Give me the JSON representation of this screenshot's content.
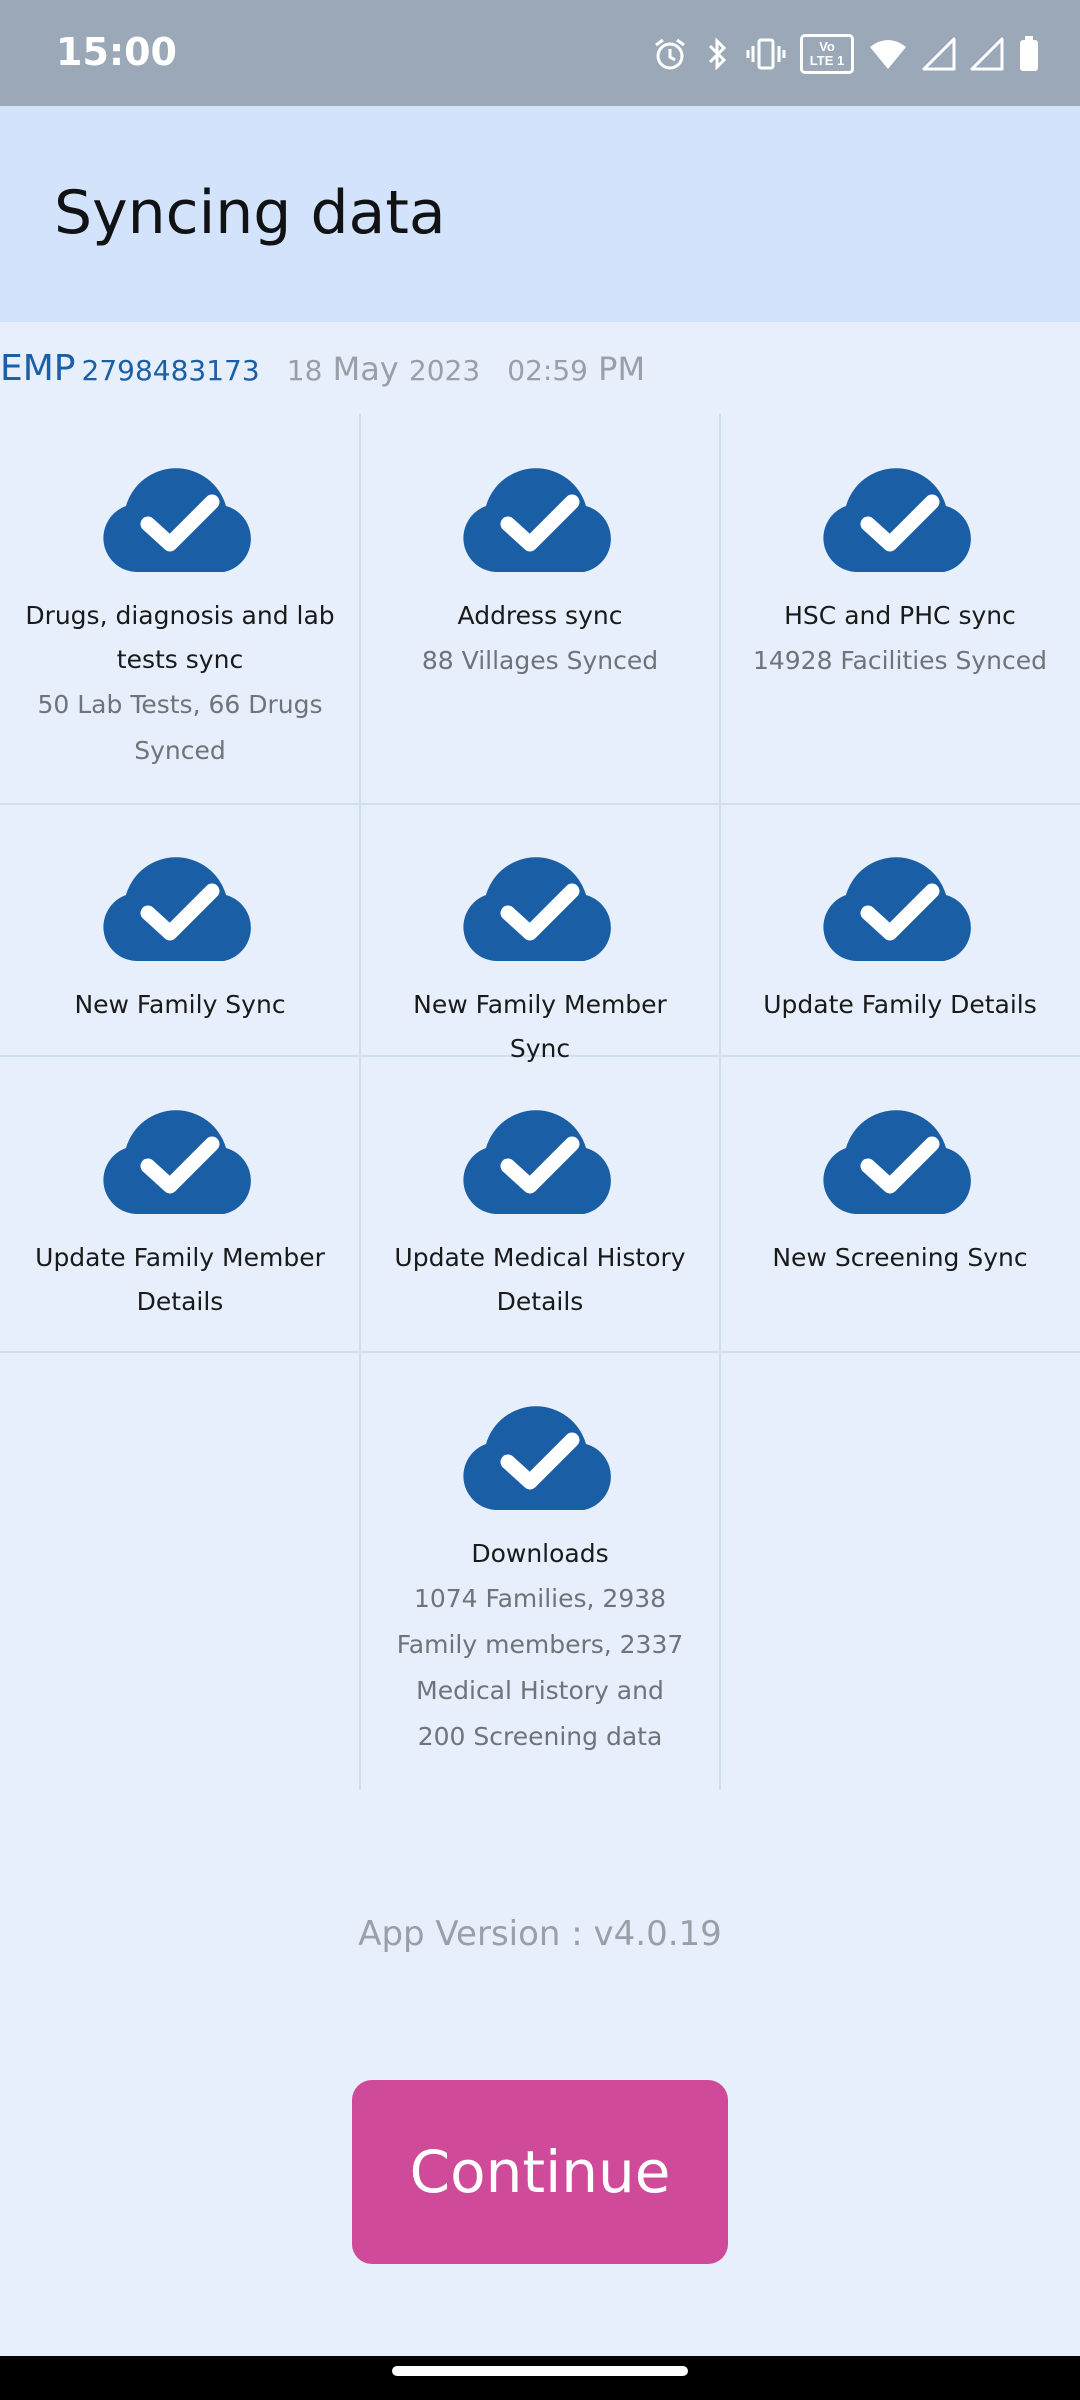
{
  "status_bar": {
    "time": "15:00",
    "icons": [
      "alarm-icon",
      "bluetooth-icon",
      "vibrate-icon",
      "volte-icon",
      "wifi-icon",
      "signal-icon",
      "signal-icon",
      "battery-icon"
    ],
    "volte_top": "Vo",
    "volte_bottom": "LTE 1"
  },
  "header": {
    "title": "Syncing data"
  },
  "meta": {
    "emp_label": "EMP",
    "emp_id": "2798483173",
    "date_day": "18",
    "date_month": "May",
    "date_year": "2023",
    "time_value": "02:59",
    "time_period": "PM"
  },
  "sync_items": [
    {
      "title": "Drugs, diagnosis and lab tests sync",
      "subtitle": "50 Lab Tests, 66 Drugs Synced",
      "status": "synced"
    },
    {
      "title": "Address sync",
      "subtitle": "88 Villages Synced",
      "status": "synced"
    },
    {
      "title": "HSC and PHC sync",
      "subtitle": "14928 Facilities Synced",
      "status": "synced"
    },
    {
      "title": "New Family Sync",
      "subtitle": "",
      "status": "synced"
    },
    {
      "title": "New Family Member Sync",
      "subtitle": "",
      "status": "synced"
    },
    {
      "title": "Update Family Details",
      "subtitle": "",
      "status": "synced"
    },
    {
      "title": "Update Family Member Details",
      "subtitle": "",
      "status": "synced"
    },
    {
      "title": "Update Medical History Details",
      "subtitle": "",
      "status": "synced"
    },
    {
      "title": "New Screening Sync",
      "subtitle": "",
      "status": "synced"
    },
    {
      "title": "Downloads",
      "subtitle": "1074 Families, 2938 Family members, 2337 Medical History and 200 Screening data",
      "status": "synced"
    }
  ],
  "footer": {
    "version_label": "App Version : v4.0.19",
    "continue_label": "Continue"
  },
  "colors": {
    "accent": "#1b5fa8",
    "cloud": "#1a5ea6",
    "header_bg": "#d2e3fb",
    "page_bg": "#e6effb",
    "continue_bg": "#d04a9a",
    "status_bar_bg": "#9ba8b8"
  }
}
